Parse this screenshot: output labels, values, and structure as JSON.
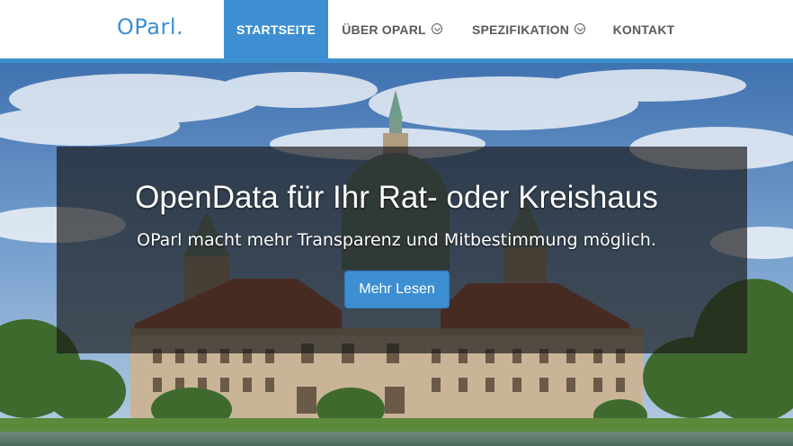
{
  "header": {
    "logo": "OParl.",
    "nav": [
      {
        "label": "STARTSEITE",
        "active": true
      },
      {
        "label": "ÜBER OPARL",
        "dropdown": true
      },
      {
        "label": "SPEZIFIKATION",
        "dropdown": true
      },
      {
        "label": "KONTAKT"
      }
    ]
  },
  "hero": {
    "title": "OpenData für Ihr Rat- oder Kreishaus",
    "subtitle": "OParl macht mehr Transparenz und Mitbestimmung möglich.",
    "button_label": "Mehr Lesen"
  },
  "colors": {
    "accent": "#3d8fd1",
    "nav_text": "#5a5a5a",
    "overlay": "rgba(25,25,25,0.68)"
  },
  "icons": {
    "dropdown": "chevron-down-circle-icon"
  }
}
